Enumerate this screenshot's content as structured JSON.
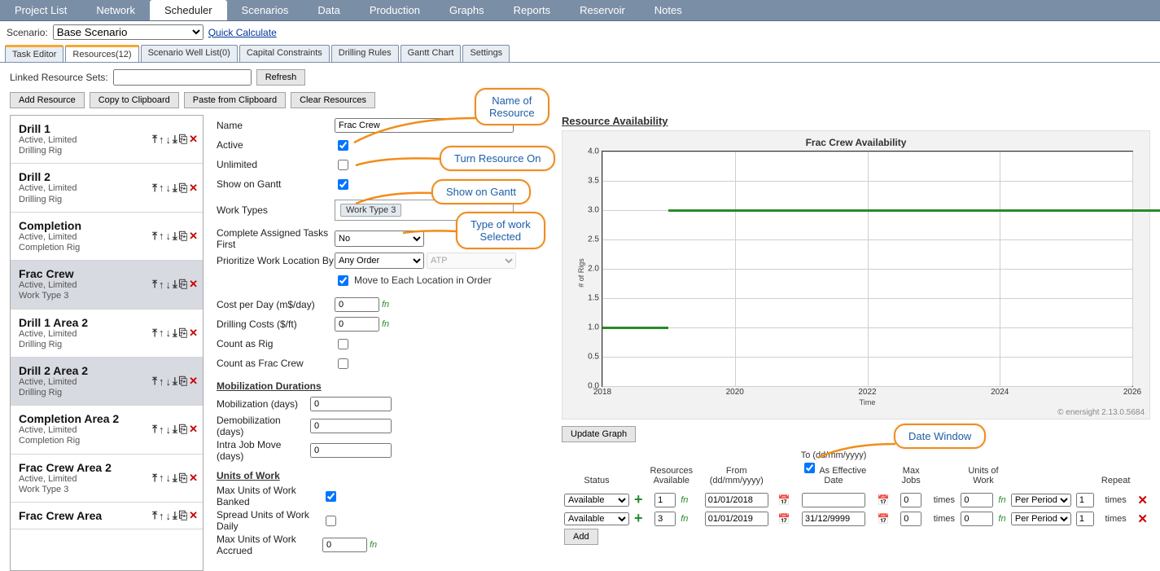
{
  "topnav": {
    "items": [
      "Project List",
      "Network",
      "Scheduler",
      "Scenarios",
      "Data",
      "Production",
      "Graphs",
      "Reports",
      "Reservoir",
      "Notes"
    ],
    "active": 2
  },
  "scenario": {
    "label": "Scenario:",
    "selected": "Base Scenario",
    "quick": "Quick Calculate"
  },
  "subtabs": {
    "items": [
      "Task Editor",
      "Resources(12)",
      "Scenario Well List(0)",
      "Capital Constraints",
      "Drilling Rules",
      "Gantt Chart",
      "Settings"
    ],
    "active": 1
  },
  "linked": {
    "label": "Linked Resource Sets:",
    "value": "",
    "refresh": "Refresh"
  },
  "rowbtns": {
    "add": "Add Resource",
    "copy": "Copy to Clipboard",
    "paste": "Paste from Clipboard",
    "clear": "Clear Resources"
  },
  "resources": [
    {
      "name": "Drill 1",
      "sub": "Active, Limited\nDrilling Rig",
      "sel": false
    },
    {
      "name": "Drill 2",
      "sub": "Active, Limited\nDrilling Rig",
      "sel": false
    },
    {
      "name": "Completion",
      "sub": "Active, Limited\nCompletion Rig",
      "sel": false
    },
    {
      "name": "Frac Crew",
      "sub": "Active, Limited\nWork Type 3",
      "sel": true
    },
    {
      "name": "Drill 1 Area 2",
      "sub": "Active, Limited\nDrilling Rig",
      "sel": false
    },
    {
      "name": "Drill 2 Area 2",
      "sub": "Active, Limited\nDrilling Rig",
      "sel": true
    },
    {
      "name": "Completion Area 2",
      "sub": "Active, Limited\nCompletion Rig",
      "sel": false
    },
    {
      "name": "Frac Crew Area 2",
      "sub": "Active, Limited\nWork Type 3",
      "sel": false
    },
    {
      "name": "Frac Crew Area",
      "sub": "",
      "sel": false
    }
  ],
  "form": {
    "name_l": "Name",
    "name": "Frac Crew",
    "active_l": "Active",
    "active": true,
    "unlimited_l": "Unlimited",
    "unlimited": false,
    "gantt_l": "Show on Gantt",
    "gantt": true,
    "wt_l": "Work Types",
    "wt_chip": "Work Type 3",
    "caf_l": "Complete Assigned Tasks First",
    "caf": "No",
    "pwl_l": "Prioritize Work Location By",
    "pwl": "Any Order",
    "pwl2": "ATP",
    "movecb_l": "Move to Each Location in Order",
    "movecb": true,
    "cpd_l": "Cost per Day (m$/day)",
    "cpd": "0",
    "dc_l": "Drilling Costs ($/ft)",
    "dc": "0",
    "car_l": "Count as Rig",
    "car": false,
    "cafc_l": "Count as Frac Crew",
    "cafc": false,
    "mob_hdr": "Mobilization Durations",
    "mob_l": "Mobilization (days)",
    "mob": "0",
    "demob_l": "Demobilization (days)",
    "demob": "0",
    "intra_l": "Intra Job Move (days)",
    "intra": "0",
    "uow_hdr": "Units of Work",
    "bank_l": "Max Units of Work Banked",
    "bank": true,
    "spread_l": "Spread Units of Work Daily",
    "spread": false,
    "accr_l": "Max Units of Work Accrued",
    "accr": "0"
  },
  "callouts": {
    "c1": "Name of\nResource",
    "c2": "Turn Resource On",
    "c3": "Show on Gantt",
    "c4": "Type of work\nSelected",
    "c5": "Date Window"
  },
  "chart": {
    "hdr": "Resource Availability",
    "title": "Frac Crew Availability",
    "ylab": "# of Rigs",
    "xlab": "Time",
    "brand": "© enersight 2.13.0.5684",
    "update_btn": "Update Graph"
  },
  "chart_data": {
    "type": "line-step",
    "title": "Frac Crew Availability",
    "xlabel": "Time",
    "ylabel": "# of Rigs",
    "ylim": [
      0,
      4.0
    ],
    "yticks": [
      0.0,
      0.5,
      1.0,
      1.5,
      2.0,
      2.5,
      3.0,
      3.5,
      4.0
    ],
    "xticks": [
      2018,
      2020,
      2022,
      2024,
      2026
    ],
    "series": [
      {
        "name": "Frac Crew",
        "steps": [
          {
            "x0": 2018,
            "x1": 2019,
            "y": 1
          },
          {
            "x0": 2019,
            "x1": 2027,
            "y": 3
          }
        ]
      }
    ]
  },
  "avail_tbl": {
    "cols": {
      "status": "Status",
      "res_av": "Resources\nAvailable",
      "from": "From (dd/mm/yyyy)",
      "to": "To (dd/mm/yyyy)",
      "eff": "As Effective Date",
      "maxjobs": "Max Jobs",
      "times": "times",
      "uow": "Units of Work",
      "perper": "Per Period",
      "repeat": "Repeat"
    },
    "rows": [
      {
        "status": "Available",
        "res": "1",
        "from": "01/01/2018",
        "to": "",
        "max": "0",
        "uow": "0",
        "rep": "1"
      },
      {
        "status": "Available",
        "res": "3",
        "from": "01/01/2019",
        "to": "31/12/9999",
        "max": "0",
        "uow": "0",
        "rep": "1"
      }
    ],
    "add": "Add"
  }
}
